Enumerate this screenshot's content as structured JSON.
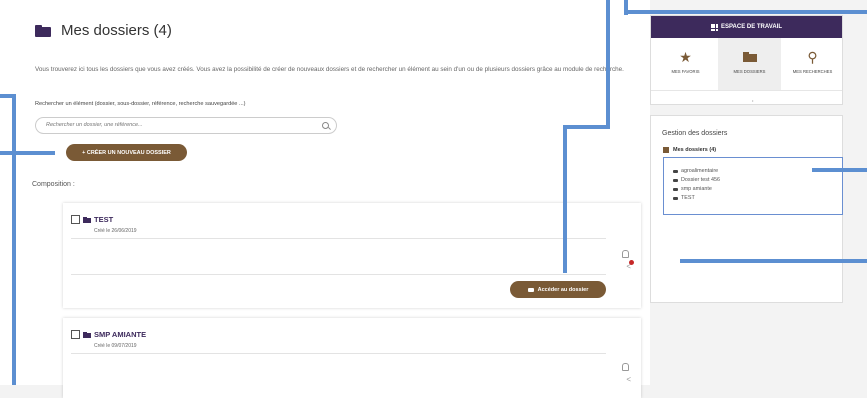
{
  "page": {
    "title": "Mes dossiers (4)",
    "intro": "Vous trouverez ici tous les dossiers que vous avez créés. Vous avez la possibilité de créer de nouveaux dossiers et de rechercher un élément au sein d'un ou de plusieurs dossiers grâce au module de recherche.",
    "search_label": "Rechercher un élément (dossier, sous-dossier, référence, recherche sauvegardée ...)",
    "search_placeholder": "Rechercher un dossier, une référence...",
    "create_button": "+ CRÉER UN NOUVEAU DOSSIER",
    "composition_label": "Composition :"
  },
  "cards": [
    {
      "name": "TEST",
      "date": "Créé le 26/06/2019",
      "access_label": "Accéder au dossier",
      "notification": true
    },
    {
      "name": "SMP AMIANTE",
      "date": "Créé le 09/07/2019"
    }
  ],
  "workspace": {
    "header": "ESPACE DE TRAVAIL",
    "tabs": [
      {
        "label": "MES FAVORIS",
        "icon": "star-icon"
      },
      {
        "label": "MES DOSSIERS",
        "icon": "folder-icon",
        "active": true
      },
      {
        "label": "MES RECHERCHES",
        "icon": "user-search-icon"
      }
    ],
    "dot": "•"
  },
  "gestion": {
    "title": "Gestion des dossiers",
    "root": "Mes dossiers (4)",
    "items": [
      "agroalimentaire",
      "Dossier test 456",
      "smp amiante",
      "TEST"
    ]
  },
  "colors": {
    "brand_purple": "#3d2a5c",
    "brown": "#7a5a36",
    "callout_blue": "#5c8fd1"
  }
}
